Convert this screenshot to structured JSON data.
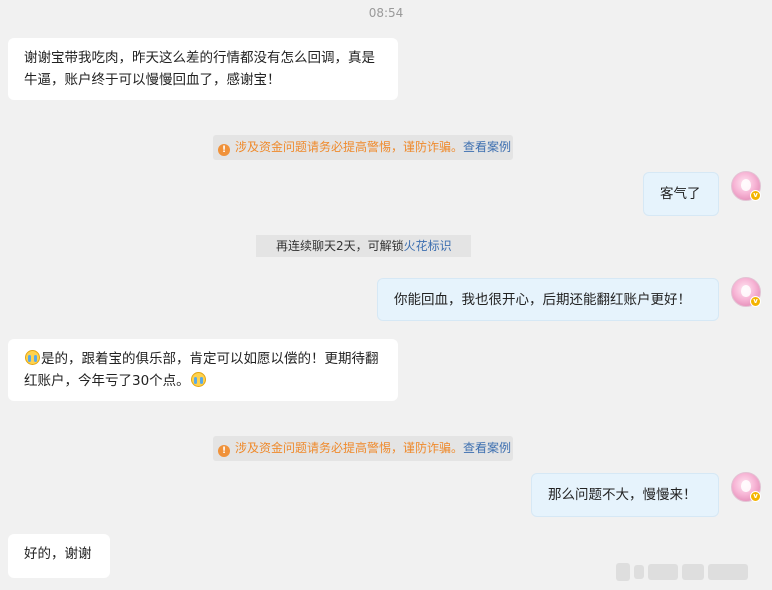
{
  "timestamp": "08:54",
  "messages": {
    "m1": "谢谢宝带我吃肉，昨天这么差的行情都没有怎么回调，真是牛逼，账户终于可以慢慢回血了，感谢宝！",
    "m2": "客气了",
    "m3": "你能回血，我也很开心，后期还能翻红账户更好！",
    "m4a": "是的，跟着宝的俱乐部，肯定可以如愿以偿的！更期待翻红账户，今年亏了30个点。",
    "m5": "那么问题不大，慢慢来！",
    "m6": "好的，谢谢"
  },
  "notice": {
    "icon": "warning-icon",
    "text": "涉及资金问题请务必提高警惕，谨防诈骗。",
    "link": "查看案例"
  },
  "spark": {
    "text": "再连续聊天2天，可解锁",
    "link": "火花标识"
  },
  "colors": {
    "background": "#f1f1f1",
    "incoming_bubble": "#ffffff",
    "outgoing_bubble": "#e6f3fc",
    "warning": "#ef8a2c",
    "link": "#3d6fb0"
  }
}
